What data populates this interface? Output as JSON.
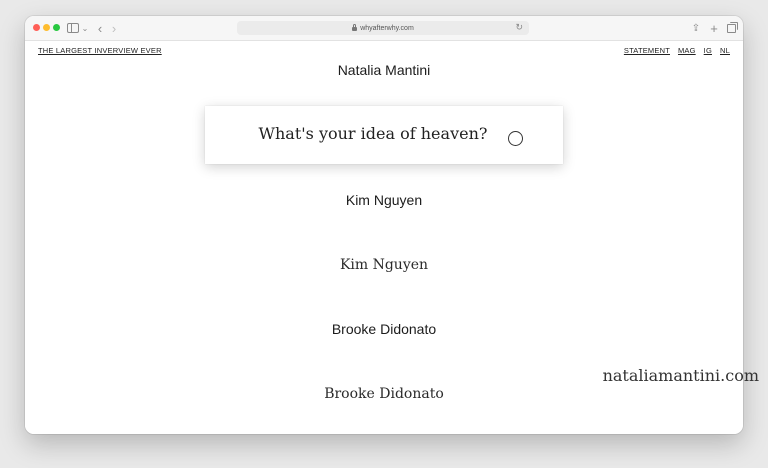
{
  "browser": {
    "url": "whyafterwhy.com",
    "icons": [
      "sidebar-icon",
      "chevron-down-icon",
      "back-arrow-icon",
      "forward-arrow-icon",
      "lock-icon",
      "reload-icon",
      "share-icon",
      "plus-icon",
      "tabs-icon"
    ]
  },
  "site": {
    "title_link": "THE LARGEST INVERVIEW EVER",
    "nav": [
      "STATEMENT",
      "MAG",
      "IG",
      "NL"
    ]
  },
  "content": {
    "names": [
      "Natalia Mantini",
      "Kim Nguyen",
      "Kim Nguyen",
      "Brooke Didonato",
      "Brooke Didonato"
    ],
    "question": "What's your idea of heaven?"
  },
  "watermark": "nataliamantini.com"
}
